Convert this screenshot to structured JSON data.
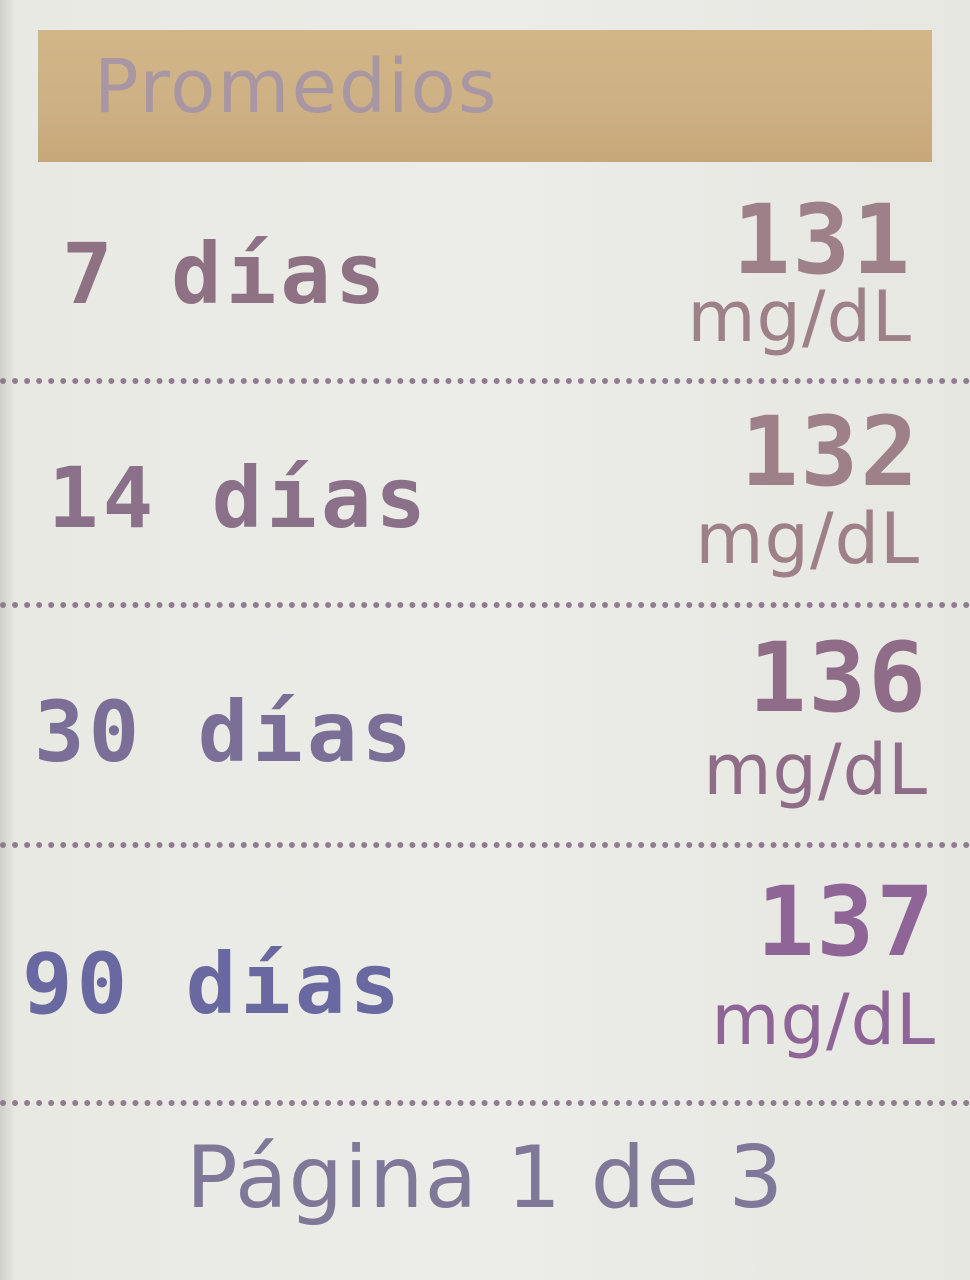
{
  "header": {
    "title": "Promedios"
  },
  "averages": [
    {
      "label": "7 días",
      "value": "131",
      "unit": "mg/dL"
    },
    {
      "label": "14 días",
      "value": "132",
      "unit": "mg/dL"
    },
    {
      "label": "30 días",
      "value": "136",
      "unit": "mg/dL"
    },
    {
      "label": "90 días",
      "value": "137",
      "unit": "mg/dL"
    }
  ],
  "footer": {
    "page_text": "Página 1 de 3"
  }
}
